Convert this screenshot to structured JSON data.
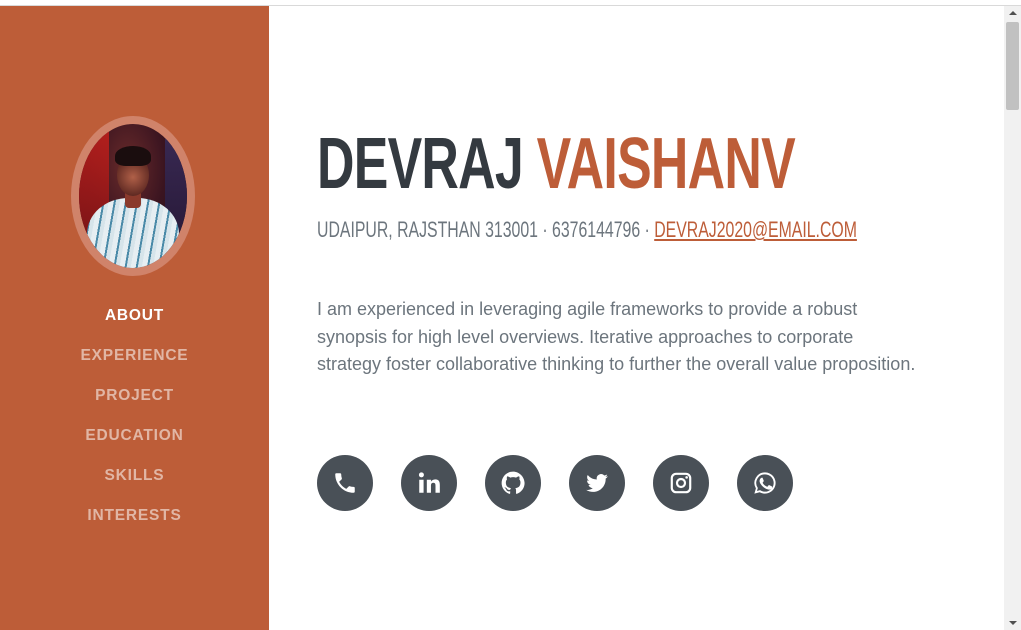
{
  "sidebar": {
    "nav": [
      {
        "label": "About",
        "active": true
      },
      {
        "label": "Experience"
      },
      {
        "label": "Project"
      },
      {
        "label": "Education"
      },
      {
        "label": "Skills"
      },
      {
        "label": "Interests"
      }
    ]
  },
  "about": {
    "first_name": "Devraj",
    "last_name": "Vaishanv",
    "address": "Udaipur, Rajsthan 313001 · 6376144796 · ",
    "email": "devraj2020@email.com",
    "bio": "I am experienced in leveraging agile frameworks to provide a robust synopsis for high level overviews. Iterative approaches to corporate strategy foster collaborative thinking to further the overall value proposition."
  },
  "social_icons": [
    "phone-icon",
    "linkedin-icon",
    "github-icon",
    "twitter-icon",
    "instagram-icon",
    "whatsapp-icon"
  ],
  "colors": {
    "primary": "#bd5d38",
    "dark": "#343a40",
    "muted": "#6c757d",
    "icon_bg": "#495057"
  }
}
